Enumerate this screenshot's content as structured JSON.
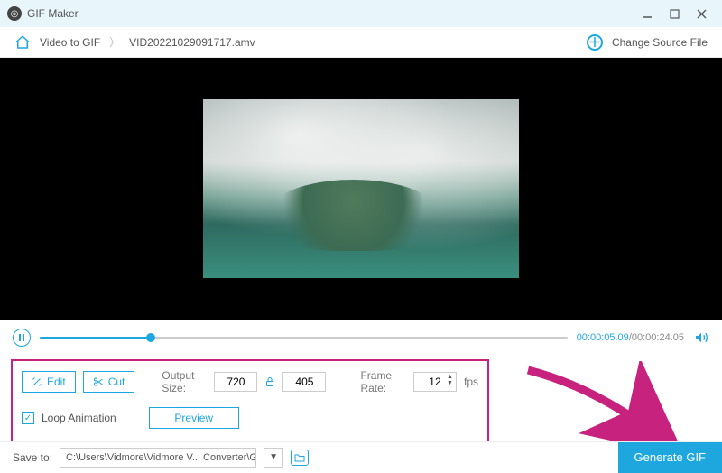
{
  "app": {
    "title": "GIF Maker"
  },
  "breadcrumb": {
    "root": "Video to GIF",
    "file": "VID20221029091717.amv",
    "change_source": "Change Source File"
  },
  "player": {
    "current_time": "00:00:05.09",
    "total_time": "00:00:24.05",
    "progress_pct": 21
  },
  "options": {
    "edit_label": "Edit",
    "cut_label": "Cut",
    "output_size_label": "Output Size:",
    "width": "720",
    "height": "405",
    "frame_rate_label": "Frame Rate:",
    "frame_rate": "12",
    "fps_label": "fps",
    "loop_label": "Loop Animation",
    "loop_checked": true,
    "preview_label": "Preview"
  },
  "footer": {
    "save_to_label": "Save to:",
    "path": "C:\\Users\\Vidmore\\Vidmore V... Converter\\GIF Maker",
    "generate_label": "Generate GIF"
  }
}
